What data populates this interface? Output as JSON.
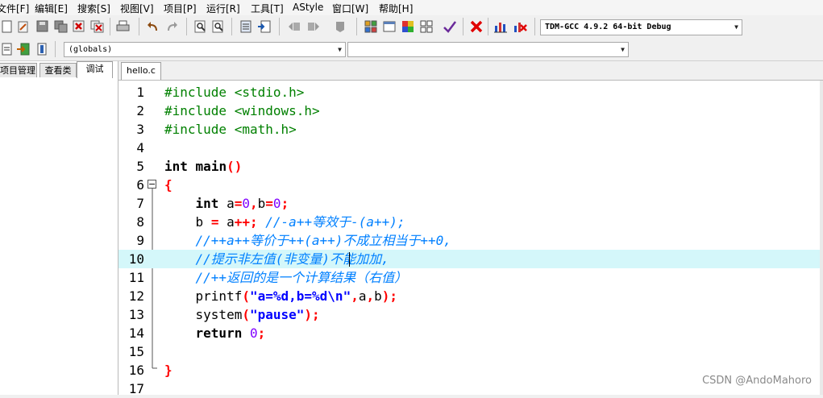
{
  "menu": [
    "文件[F]",
    "编辑[E]",
    "搜索[S]",
    "视图[V]",
    "项目[P]",
    "运行[R]",
    "工具[T]",
    "AStyle",
    "窗口[W]",
    "帮助[H]"
  ],
  "toolbar": {
    "compiler": "TDM-GCC 4.9.2 64-bit Debug",
    "scope_combo": "(globals)",
    "member_combo": ""
  },
  "left_tabs": [
    "项目管理",
    "查看类",
    "调试"
  ],
  "editor": {
    "tab": "hello.c",
    "line_numbers": [
      "1",
      "2",
      "3",
      "4",
      "5",
      "6",
      "7",
      "8",
      "9",
      "10",
      "11",
      "12",
      "13",
      "14",
      "15",
      "16",
      "17"
    ],
    "code": {
      "l1_directive": "#include",
      "l1_header": "<stdio.h>",
      "l2_directive": "#include",
      "l2_header": "<windows.h>",
      "l3_directive": "#include",
      "l3_header": "<math.h>",
      "l5_type": "int",
      "l5_name": "main",
      "l5_parens": "()",
      "l6_brace": "{",
      "l7_type": "int",
      "l7_a": "a",
      "l7_eq1": "=",
      "l7_zero1": "0",
      "l7_comma": ",",
      "l7_b": "b",
      "l7_eq2": "=",
      "l7_zero2": "0",
      "l7_semi": ";",
      "l8_b": "b",
      "l8_eq": "=",
      "l8_a": "a",
      "l8_inc": "++;",
      "l8_comment": "//-a++等效于-(a++);",
      "l9_comment": "//++a++等价于++(a++)不成立相当于++0,",
      "l10_comment": "//提示非左值(非变量)不能加加,",
      "l11_comment": "//++返回的是一个计算结果（右值）",
      "l12_func": "printf",
      "l12_open": "(",
      "l12_str": "\"a=%d,b=%d\\n\"",
      "l12_comma1": ",",
      "l12_a": "a",
      "l12_comma2": ",",
      "l12_b": "b",
      "l12_close": ");",
      "l13_func": "system",
      "l13_open": "(",
      "l13_str": "\"pause\"",
      "l13_close": ");",
      "l14_kw": "return",
      "l14_num": "0",
      "l14_semi": ";",
      "l16_brace": "}"
    },
    "fold_open": "−"
  },
  "watermark": "CSDN @AndoMahoro"
}
